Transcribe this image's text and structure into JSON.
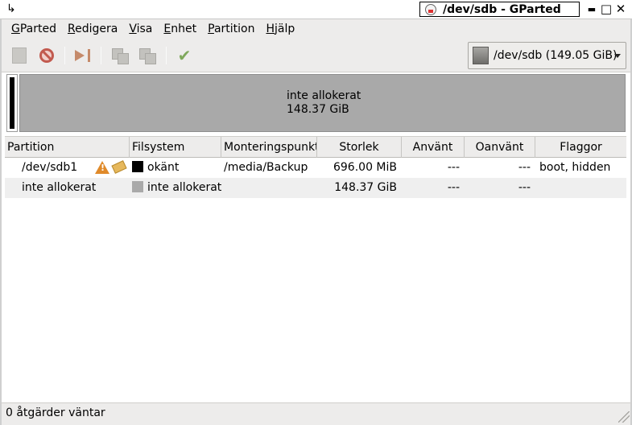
{
  "window": {
    "title": "/dev/sdb - GParted",
    "corner_glyph": "↳",
    "minimize_glyph": "▬",
    "maximize_glyph": "□",
    "close_glyph": "✕"
  },
  "menu": {
    "items": [
      {
        "underline": "G",
        "rest": "Parted"
      },
      {
        "underline": "R",
        "rest": "edigera"
      },
      {
        "underline": "V",
        "rest": "isa"
      },
      {
        "underline": "E",
        "rest": "nhet"
      },
      {
        "underline": "P",
        "rest": "artition"
      },
      {
        "underline": "H",
        "rest": "jälp"
      }
    ]
  },
  "toolbar": {
    "icons": [
      "new-partition-icon",
      "delete-icon",
      "resize-move-icon",
      "copy-icon",
      "paste-icon",
      "apply-icon"
    ],
    "apply_glyph": "✔",
    "device": "/dev/sdb  (149.05 GiB)"
  },
  "disk_graph": {
    "unallocated_label": "inte allokerat",
    "unallocated_size": "148.37 GiB",
    "colors": {
      "unallocated": "#a9a9a9",
      "unknown_fs": "#000000"
    }
  },
  "table": {
    "headers": {
      "partition": "Partition",
      "filesystem": "Filsystem",
      "mountpoint": "Monteringspunkt",
      "size": "Storlek",
      "used": "Använt",
      "unused": "Oanvänt",
      "flags": "Flaggor"
    },
    "rows": [
      {
        "partition": "/dev/sdb1",
        "filesystem": "okänt",
        "fs_color": "#000000",
        "mountpoint": "/media/Backup",
        "size": "696.00 MiB",
        "used": "---",
        "unused": "---",
        "flags": "boot, hidden",
        "warn_glyph": "!"
      },
      {
        "partition": "inte allokerat",
        "filesystem": "inte allokerat",
        "fs_color": "#a9a9a9",
        "mountpoint": "",
        "size": "148.37 GiB",
        "used": "---",
        "unused": "---",
        "flags": ""
      }
    ]
  },
  "status": {
    "text": "0 åtgärder väntar"
  }
}
